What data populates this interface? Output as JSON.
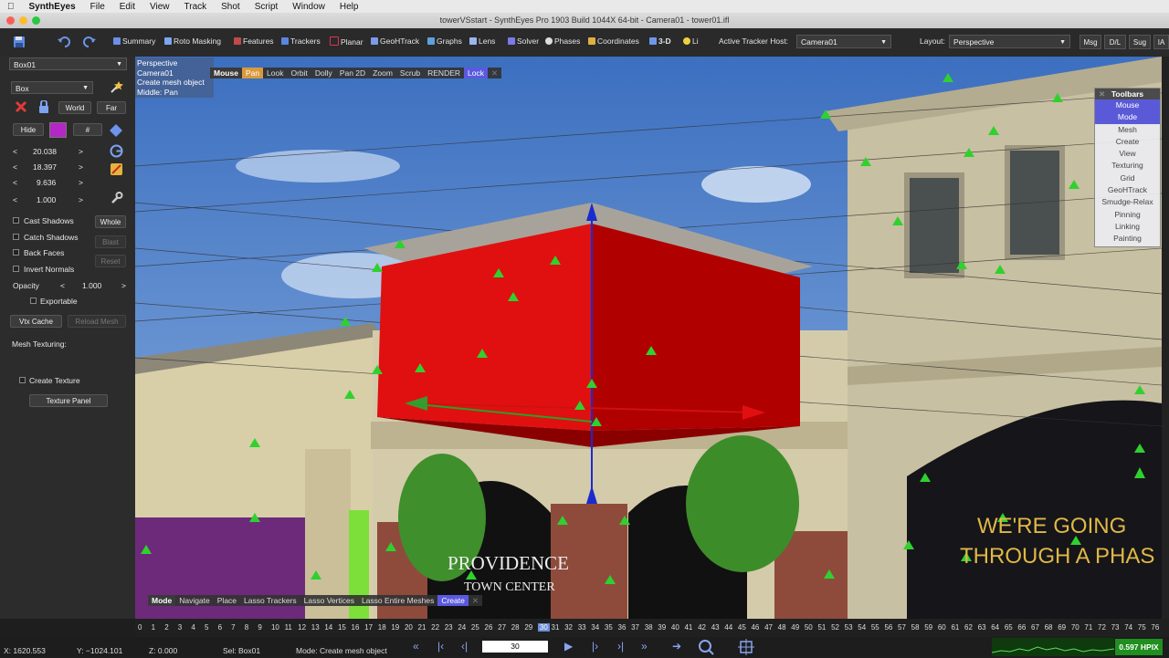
{
  "menubar": {
    "app_name": "SynthEyes",
    "items": [
      "File",
      "Edit",
      "View",
      "Track",
      "Shot",
      "Script",
      "Window",
      "Help"
    ]
  },
  "window": {
    "title": "towerVSstart - SynthEyes Pro 1903 Build 1044X 64-bit - Camera01 - tower01.ifl"
  },
  "toolbar": {
    "rooms": [
      "Summary",
      "Roto Masking",
      "Features",
      "Trackers",
      "Planar",
      "GeoHTrack",
      "Graphs",
      "Lens",
      "Solver",
      "Phases",
      "Coordinates",
      "3-D",
      "Li"
    ],
    "active_room": "3-D",
    "active_tracker_host_label": "Active Tracker Host:",
    "active_tracker_host_value": "Camera01",
    "layout_label": "Layout:",
    "layout_value": "Perspective",
    "buttons": [
      "Msg",
      "D/L",
      "Sug",
      "IA"
    ]
  },
  "left_panel": {
    "object_select": "Box01",
    "type_select": "Box",
    "world_button": "World",
    "far_button": "Far",
    "hide_button": "Hide",
    "hash_button": "#",
    "swatch_color": "#b327c4",
    "values": [
      "20.038",
      "18.397",
      "9.636",
      "1.000"
    ],
    "cast_shadows": "Cast Shadows",
    "whole_button": "Whole",
    "catch_shadows": "Catch Shadows",
    "blast_button": "Blast",
    "back_faces": "Back Faces",
    "reset_button": "Reset",
    "invert_normals": "Invert Normals",
    "opacity_label": "Opacity",
    "opacity_value": "1.000",
    "exportable": "Exportable",
    "vtx_cache_button": "Vtx Cache",
    "reload_mesh_button": "Reload Mesh",
    "mesh_texturing_label": "Mesh Texturing:",
    "create_texture": "Create Texture",
    "texture_panel_button": "Texture Panel"
  },
  "viewport": {
    "info_lines": [
      "Perspective",
      "Camera01",
      "Create mesh object",
      "Middle: Pan"
    ],
    "mouse_bar": [
      "Mouse",
      "Pan",
      "Look",
      "Orbit",
      "Dolly",
      "Pan 2D",
      "Zoom",
      "Scrub",
      "RENDER",
      "Lock"
    ],
    "mouse_bar_selected": "Pan",
    "mode_bar": [
      "Mode",
      "Navigate",
      "Place",
      "Lasso Trackers",
      "Lasso Vertices",
      "Lasso Entire Meshes",
      "Create"
    ],
    "mode_bar_selected": "Create",
    "toolbars_title": "Toolbars",
    "toolbars_items": [
      "Mouse",
      "Mode",
      "Mesh",
      "Create",
      "View",
      "Texturing",
      "Grid",
      "GeoHTrack",
      "Smudge-Relax",
      "Pinning",
      "Linking",
      "Painting"
    ],
    "sign_text_1": "PROVIDENCE",
    "sign_text_2": "TOWN CENTER",
    "sign_text_3": "WE'RE GOING",
    "sign_text_4": "THROUGH A PHAS"
  },
  "timeline": {
    "frames": [
      "0",
      "1",
      "2",
      "3",
      "4",
      "5",
      "6",
      "7",
      "8",
      "9",
      "10",
      "11",
      "12",
      "13",
      "14",
      "15",
      "16",
      "17",
      "18",
      "19",
      "20",
      "21",
      "22",
      "23",
      "24",
      "25",
      "26",
      "27",
      "28",
      "29",
      "30",
      "31",
      "32",
      "33",
      "34",
      "35",
      "36",
      "37",
      "38",
      "39",
      "40",
      "41",
      "42",
      "43",
      "44",
      "45",
      "46",
      "47",
      "48",
      "49",
      "50",
      "51",
      "52",
      "53",
      "54",
      "55",
      "56",
      "57",
      "58",
      "59",
      "60",
      "61",
      "62",
      "63",
      "64",
      "65",
      "66",
      "67",
      "68",
      "69",
      "70",
      "71",
      "72",
      "73",
      "74",
      "75",
      "76"
    ],
    "current_frame": "30"
  },
  "status": {
    "x": "X:   1620.553",
    "y": "Y:  −1024.101",
    "z": "Z:     0.000",
    "sel": "Sel: Box01",
    "mode": "Mode: Create mesh object",
    "frame_value": "30",
    "hpix": "0.597 HPIX"
  }
}
